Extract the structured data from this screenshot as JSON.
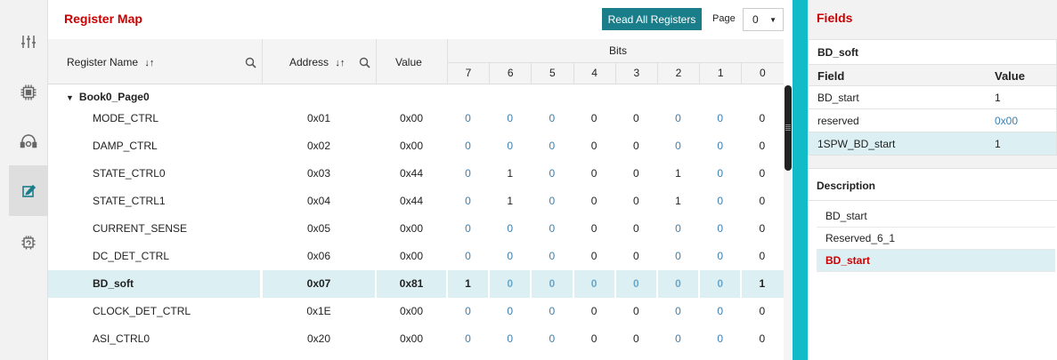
{
  "register_map": {
    "title": "Register Map",
    "read_all_label": "Read All Registers",
    "page_label": "Page",
    "page_value": "0",
    "columns": {
      "name": "Register Name",
      "address": "Address",
      "value": "Value",
      "bits": "Bits",
      "bit_labels": [
        "7",
        "6",
        "5",
        "4",
        "3",
        "2",
        "1",
        "0"
      ]
    },
    "group": "Book0_Page0",
    "rows": [
      {
        "name": "MODE_CTRL",
        "address": "0x01",
        "value": "0x00",
        "bits": [
          "0",
          "0",
          "0",
          "0",
          "0",
          "0",
          "0",
          "0"
        ]
      },
      {
        "name": "DAMP_CTRL",
        "address": "0x02",
        "value": "0x00",
        "bits": [
          "0",
          "0",
          "0",
          "0",
          "0",
          "0",
          "0",
          "0"
        ]
      },
      {
        "name": "STATE_CTRL0",
        "address": "0x03",
        "value": "0x44",
        "bits": [
          "0",
          "1",
          "0",
          "0",
          "0",
          "1",
          "0",
          "0"
        ]
      },
      {
        "name": "STATE_CTRL1",
        "address": "0x04",
        "value": "0x44",
        "bits": [
          "0",
          "1",
          "0",
          "0",
          "0",
          "1",
          "0",
          "0"
        ]
      },
      {
        "name": "CURRENT_SENSE",
        "address": "0x05",
        "value": "0x00",
        "bits": [
          "0",
          "0",
          "0",
          "0",
          "0",
          "0",
          "0",
          "0"
        ]
      },
      {
        "name": "DC_DET_CTRL",
        "address": "0x06",
        "value": "0x00",
        "bits": [
          "0",
          "0",
          "0",
          "0",
          "0",
          "0",
          "0",
          "0"
        ]
      },
      {
        "name": "BD_soft",
        "address": "0x07",
        "value": "0x81",
        "bits": [
          "1",
          "0",
          "0",
          "0",
          "0",
          "0",
          "0",
          "1"
        ]
      },
      {
        "name": "CLOCK_DET_CTRL",
        "address": "0x1E",
        "value": "0x00",
        "bits": [
          "0",
          "0",
          "0",
          "0",
          "0",
          "0",
          "0",
          "0"
        ]
      },
      {
        "name": "ASI_CTRL0",
        "address": "0x20",
        "value": "0x00",
        "bits": [
          "0",
          "0",
          "0",
          "0",
          "0",
          "0",
          "0",
          "0"
        ]
      }
    ]
  },
  "fields": {
    "title": "Fields",
    "register": "BD_soft",
    "header_field": "Field",
    "header_value": "Value",
    "rows": [
      {
        "field": "BD_start",
        "value": "1"
      },
      {
        "field": "reserved",
        "value": "0x00"
      },
      {
        "field": "1SPW_BD_start",
        "value": "1"
      }
    ]
  },
  "description": {
    "title": "Description",
    "items": [
      "BD_start",
      "Reserved_6_1",
      "BD_start"
    ]
  },
  "colors": {
    "accent_red": "#cc0000",
    "button_teal": "#1a7e8a",
    "divider_teal": "#11bcc8",
    "selected_row": "#dcf0f4",
    "dim_value": "#3a7fb0"
  },
  "icons": [
    "sliders-icon",
    "chip-icon",
    "headset-gear-icon",
    "edit-icon",
    "chip-refresh-icon"
  ]
}
